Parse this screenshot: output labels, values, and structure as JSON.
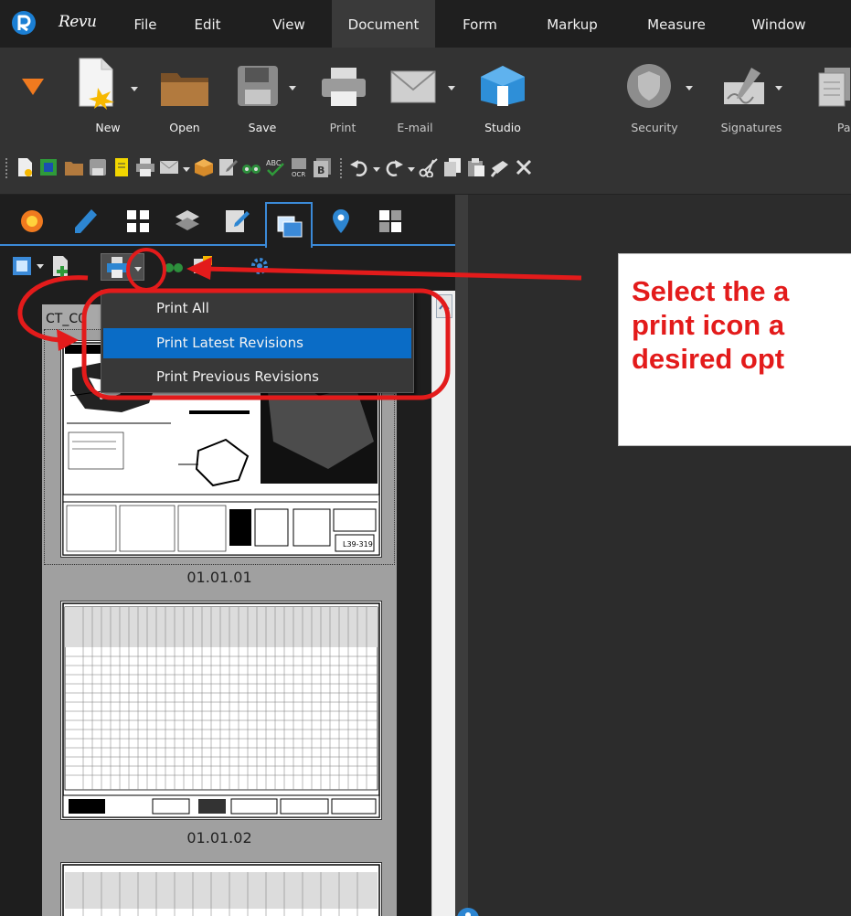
{
  "app": {
    "name": "Revu"
  },
  "menu": {
    "items": [
      "File",
      "Edit",
      "View",
      "Document",
      "Form",
      "Markup",
      "Measure",
      "Window"
    ],
    "active": "Document"
  },
  "ribbon": {
    "buttons": [
      {
        "label": "New",
        "icon": "new-document-icon"
      },
      {
        "label": "Open",
        "icon": "folder-icon"
      },
      {
        "label": "Save",
        "icon": "floppy-disk-icon"
      },
      {
        "label": "Print",
        "icon": "printer-icon"
      },
      {
        "label": "E-mail",
        "icon": "envelope-icon"
      },
      {
        "label": "Studio",
        "icon": "studio-icon"
      },
      {
        "label": "Security",
        "icon": "shield-icon"
      },
      {
        "label": "Signatures",
        "icon": "signature-pen-icon"
      },
      {
        "label": "Page",
        "icon": "pages-icon"
      }
    ]
  },
  "dropdown": {
    "items": [
      "Print All",
      "Print Latest Revisions",
      "Print Previous Revisions"
    ],
    "highlighted": "Print Latest Revisions"
  },
  "thumbnails": {
    "set_name": "CT_C0",
    "pages": [
      {
        "label": "01.01.01",
        "stamp": "L39-319"
      },
      {
        "label": "01.01.02"
      },
      {
        "label": ""
      }
    ]
  },
  "callout": {
    "lines": [
      "Select the a",
      "print icon a",
      "desired opt"
    ]
  },
  "colors": {
    "accent": "#3b8ad8",
    "highlight": "#0a6cc6",
    "annotation": "#e31b1b"
  }
}
